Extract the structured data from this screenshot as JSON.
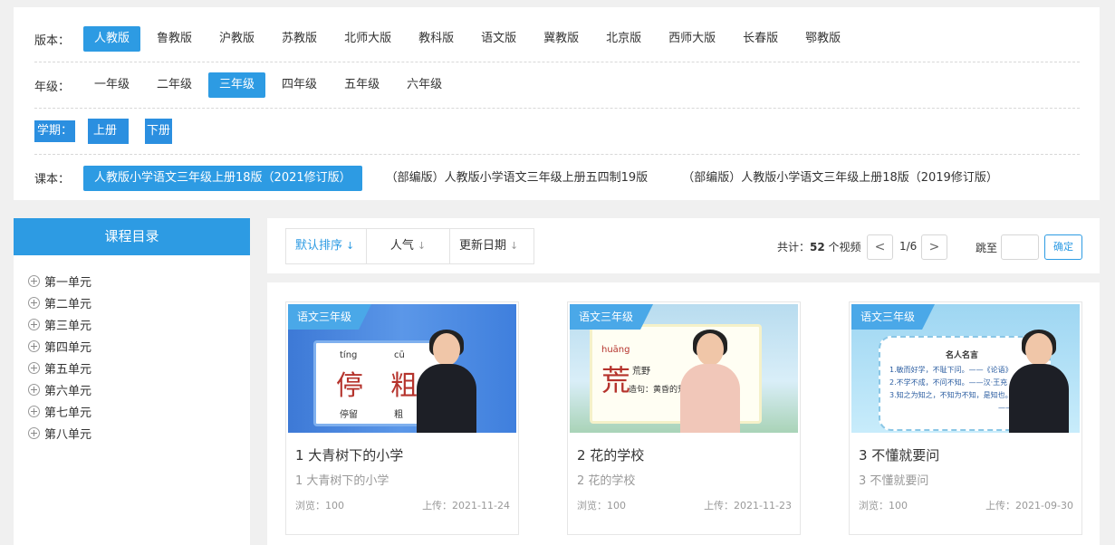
{
  "filters": {
    "version": {
      "label": "版本：",
      "options": [
        "人教版",
        "鲁教版",
        "沪教版",
        "苏教版",
        "北师大版",
        "教科版",
        "语文版",
        "冀教版",
        "北京版",
        "西师大版",
        "长春版",
        "鄂教版"
      ],
      "active": "人教版"
    },
    "grade": {
      "label": "年级：",
      "options": [
        "一年级",
        "二年级",
        "三年级",
        "四年级",
        "五年级",
        "六年级"
      ],
      "active": "三年级"
    },
    "term": {
      "label": "学期：",
      "options": [
        "上册",
        "下册"
      ]
    },
    "book": {
      "label": "课本：",
      "options": [
        "人教版小学语文三年级上册18版（2021修订版）",
        "（部编版）人教版小学语文三年级上册五四制19版",
        "（部编版）人教版小学语文三年级上册18版（2019修订版）"
      ],
      "active": "人教版小学语文三年级上册18版（2021修订版）"
    }
  },
  "sidebar": {
    "title": "课程目录",
    "units": [
      "第一单元",
      "第二单元",
      "第三单元",
      "第四单元",
      "第五单元",
      "第六单元",
      "第七单元",
      "第八单元"
    ]
  },
  "toolbar": {
    "sorts": [
      {
        "label": "默认排序",
        "icon": "arrow-down-icon"
      },
      {
        "label": "人气",
        "icon": "arrow-down-icon"
      },
      {
        "label": "更新日期",
        "icon": "arrow-down-icon"
      }
    ],
    "total_prefix": "共计：",
    "total_count": "52",
    "total_suffix": " 个视频",
    "prev": "<",
    "page": "1/6",
    "next": ">",
    "jump_label": "跳至",
    "jump_value": "",
    "confirm": "确定"
  },
  "cards": [
    {
      "tag": "语文三年级",
      "title": "1 大青树下的小学",
      "subtitle": "1 大青树下的小学",
      "views": "浏览：100",
      "date": "上传：2021-11-24",
      "thumb": {
        "hanzi": [
          "停",
          "粗"
        ],
        "pinyin": [
          "tíng",
          "cū"
        ],
        "words": [
          "停留",
          "粗"
        ]
      }
    },
    {
      "tag": "语文三年级",
      "title": "2 花的学校",
      "subtitle": "2 花的学校",
      "views": "浏览：100",
      "date": "上传：2021-11-23",
      "thumb": {
        "hanzi": [
          "荒"
        ],
        "pinyin": [
          "huāng"
        ],
        "words": [
          "荒野",
          "造句：黄昏的荒野传"
        ]
      }
    },
    {
      "tag": "语文三年级",
      "title": "3 不懂就要问",
      "subtitle": "3 不懂就要问",
      "views": "浏览：100",
      "date": "上传：2021-09-30",
      "thumb": {
        "heading": "名人名言",
        "lines": [
          "1.敏而好学，不耻下问。——《论语》",
          "2.不学不成，不问不知。——汉·王充",
          "3.知之为知之，不知为不知，是知也。",
          "——孔子"
        ]
      }
    }
  ],
  "colors": {
    "accent": "#2d9be3",
    "selection": "#2b8fe0"
  }
}
